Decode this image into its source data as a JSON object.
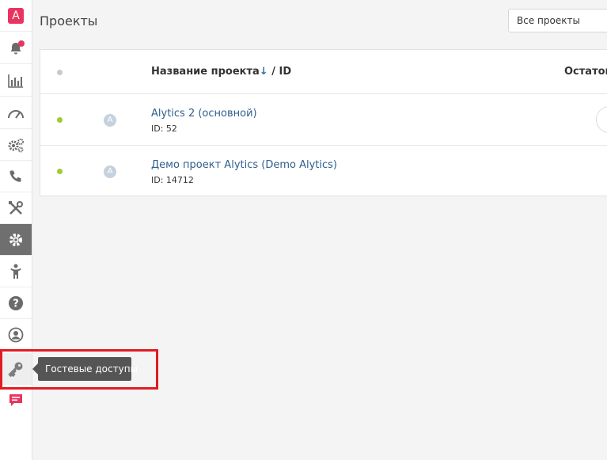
{
  "sidebar": {
    "logo_letter": "A",
    "items": [
      {
        "name": "notifications-icon"
      },
      {
        "name": "bar-chart-icon"
      },
      {
        "name": "speedometer-icon"
      },
      {
        "name": "gears-icon"
      },
      {
        "name": "phone-icon"
      },
      {
        "name": "tools-icon"
      },
      {
        "name": "settings-icon"
      },
      {
        "name": "person-icon"
      },
      {
        "name": "help-icon"
      },
      {
        "name": "user-circle-icon"
      },
      {
        "name": "key-icon"
      },
      {
        "name": "chat-icon"
      }
    ]
  },
  "tooltip": {
    "text": "Гостевые доступы"
  },
  "header": {
    "title": "Проекты",
    "filter_value": "Все проекты"
  },
  "table": {
    "header_name": "Название проекта",
    "header_sort_arrow": "↓",
    "header_id": " / ID",
    "header_rest": "Остаток",
    "rows": [
      {
        "avatar": "A",
        "name": "Alytics 2 (основной)",
        "id": "ID: 52"
      },
      {
        "avatar": "A",
        "name": "Демо проект Alytics (Demo Alytics)",
        "id": "ID: 14712"
      }
    ]
  },
  "colors": {
    "accent": "#e8345f",
    "active_item": "#6f6f6f",
    "status_active": "#9ccd33",
    "link": "#2e5f8c",
    "highlight": "#e11b22"
  }
}
